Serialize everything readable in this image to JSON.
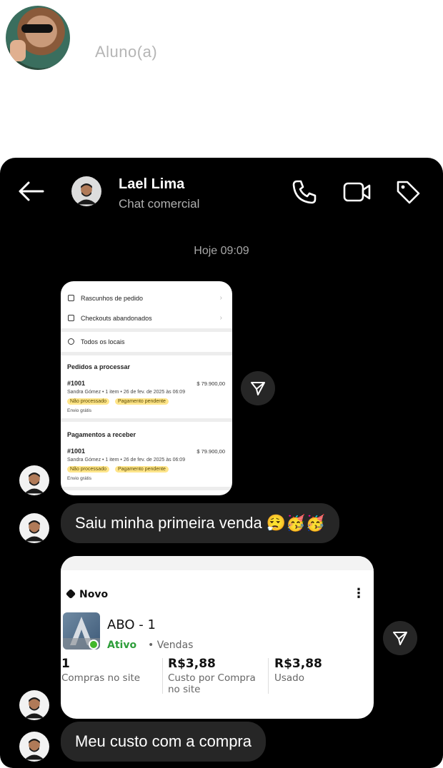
{
  "profile": {
    "role": "Aluno(a)"
  },
  "header": {
    "name": "Lael Lima",
    "subtitle": "Chat comercial"
  },
  "chat": {
    "timestamp": "Hoje 09:09"
  },
  "card1": {
    "rows": [
      "Rascunhos de pedido",
      "Checkouts abandonados",
      "Todos os locais"
    ],
    "sections": [
      {
        "title": "Pedidos a processar",
        "order": "#1001",
        "amount": "$ 79.900,00",
        "meta": "Sandra Gómez • 1 item • 26 de fev. de 2025 às 06:09",
        "badge1": "Não processado",
        "badge2": "Pagamento pendente",
        "ship": "Envio grátis"
      },
      {
        "title": "Pagamentos a receber",
        "order": "#1001",
        "amount": "$ 79.900,00",
        "meta": "Sandra Gómez • 1 item • 26 de fev. de 2025 às 06:09",
        "badge1": "Não processado",
        "badge2": "Pagamento pendente",
        "ship": "Envio grátis"
      }
    ]
  },
  "messages": {
    "m1": "Saiu minha primeira venda 😮‍💨🥳🥳",
    "m2": "Meu custo com a compra"
  },
  "card2": {
    "tag": "Novo",
    "menu": "⋮",
    "name": "ABO - 1",
    "status": "Ativo",
    "category": "• Vendas",
    "stats": [
      {
        "value": "1",
        "label": "Compras no site"
      },
      {
        "value": "R$3,88",
        "label": "Custo por Compra no site"
      },
      {
        "value": "R$3,88",
        "label": "Usado"
      }
    ]
  },
  "colors": {
    "panel": "#000000",
    "bubble": "#262626",
    "active": "#2e9e3a",
    "badge": "#ffe58a"
  }
}
